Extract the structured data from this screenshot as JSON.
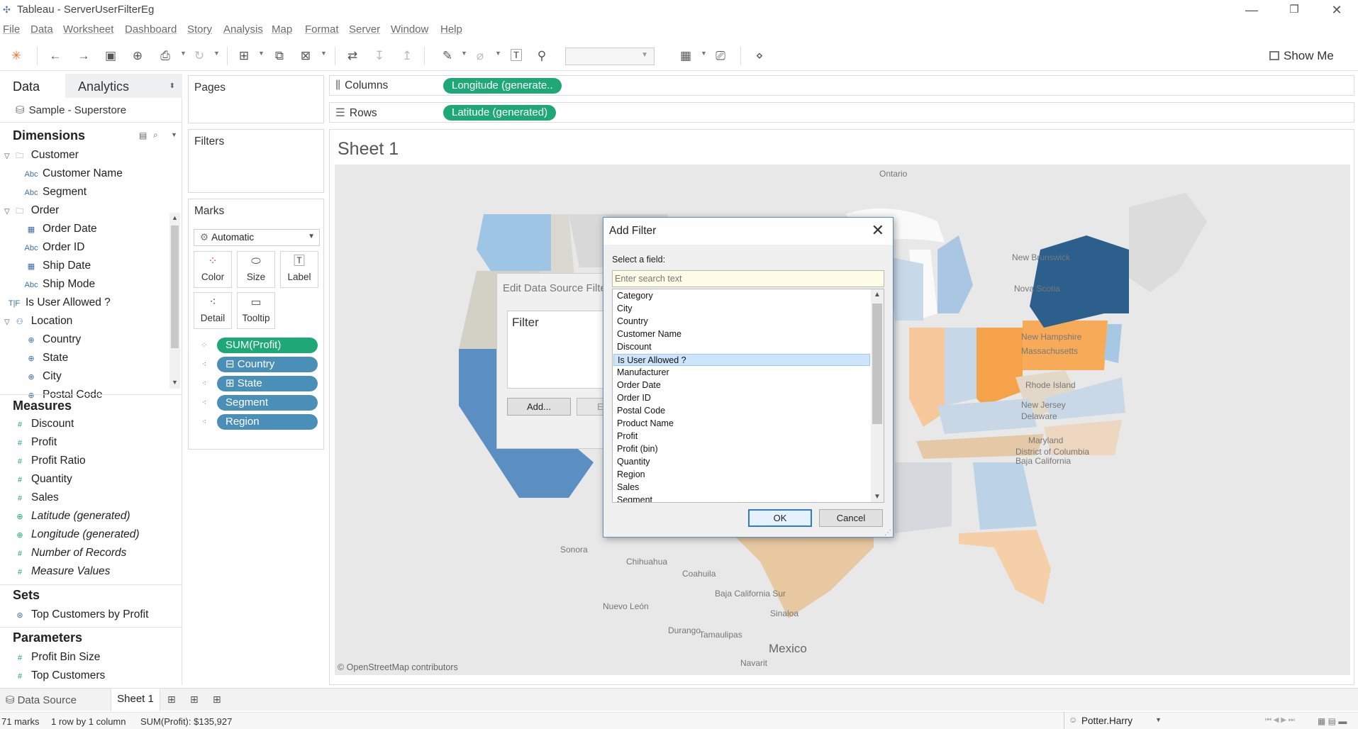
{
  "window": {
    "title": "Tableau - ServerUserFilterEg"
  },
  "menu": [
    "File",
    "Data",
    "Worksheet",
    "Dashboard",
    "Story",
    "Analysis",
    "Map",
    "Format",
    "Server",
    "Window",
    "Help"
  ],
  "toolbar": {
    "show_me": "Show Me"
  },
  "left_pane": {
    "tab_data": "Data",
    "tab_analytics": "Analytics",
    "source": "Sample - Superstore",
    "dimensions_title": "Dimensions",
    "dimensions": [
      {
        "label": "Customer",
        "icon": "folder-icon",
        "kind": "folder"
      },
      {
        "label": "Customer Name",
        "icon": "abc-icon",
        "kind": "field"
      },
      {
        "label": "Segment",
        "icon": "abc-icon",
        "kind": "field"
      },
      {
        "label": "Order",
        "icon": "folder-icon",
        "kind": "folder"
      },
      {
        "label": "Order Date",
        "icon": "calendar-icon",
        "kind": "field"
      },
      {
        "label": "Order ID",
        "icon": "abc-icon",
        "kind": "field"
      },
      {
        "label": "Ship Date",
        "icon": "calendar-icon",
        "kind": "field"
      },
      {
        "label": "Ship Mode",
        "icon": "abc-icon",
        "kind": "field"
      },
      {
        "label": "Is User Allowed ?",
        "icon": "tf-icon",
        "kind": "top"
      },
      {
        "label": "Location",
        "icon": "hierarchy-icon",
        "kind": "folder"
      },
      {
        "label": "Country",
        "icon": "globe-icon",
        "kind": "field"
      },
      {
        "label": "State",
        "icon": "globe-icon",
        "kind": "field"
      },
      {
        "label": "City",
        "icon": "globe-icon",
        "kind": "field"
      },
      {
        "label": "Postal Code",
        "icon": "globe-icon",
        "kind": "field"
      }
    ],
    "measures_title": "Measures",
    "measures": [
      {
        "label": "Discount",
        "italic": false
      },
      {
        "label": "Profit",
        "italic": false
      },
      {
        "label": "Profit Ratio",
        "italic": false
      },
      {
        "label": "Quantity",
        "italic": false
      },
      {
        "label": "Sales",
        "italic": false
      },
      {
        "label": "Latitude (generated)",
        "italic": true
      },
      {
        "label": "Longitude (generated)",
        "italic": true
      },
      {
        "label": "Number of Records",
        "italic": true
      },
      {
        "label": "Measure Values",
        "italic": true
      }
    ],
    "sets_title": "Sets",
    "sets": [
      "Top Customers by Profit"
    ],
    "parameters_title": "Parameters",
    "parameters": [
      "Profit Bin Size",
      "Top Customers"
    ]
  },
  "cards": {
    "pages": "Pages",
    "filters": "Filters",
    "marks": "Marks",
    "mark_type": "Automatic",
    "mark_buttons": [
      "Color",
      "Size",
      "Label",
      "Detail",
      "Tooltip"
    ],
    "mark_pills": [
      {
        "label": "SUM(Profit)",
        "color": "green",
        "icon": "color-icon"
      },
      {
        "label": "⊟ Country",
        "color": "blue",
        "icon": "detail-icon"
      },
      {
        "label": "⊞ State",
        "color": "blue",
        "icon": "detail-icon"
      },
      {
        "label": "Segment",
        "color": "blue",
        "icon": "detail-icon"
      },
      {
        "label": "Region",
        "color": "blue",
        "icon": "detail-icon"
      }
    ]
  },
  "shelves": {
    "columns_label": "Columns",
    "columns_pill": "Longitude (generate..",
    "rows_label": "Rows",
    "rows_pill": "Latitude (generated)"
  },
  "sheet": {
    "title": "Sheet 1",
    "attribution": "© OpenStreetMap contributors",
    "map_labels": [
      "Ontario",
      "New Brunswick",
      "Nova Scotia",
      "New Hampshire",
      "Massachusetts",
      "Rhode Island",
      "New Jersey",
      "Delaware",
      "Maryland",
      "District of Columbia",
      "Baja California",
      "Sonora",
      "Chihuahua",
      "Coahuila",
      "Baja California Sur",
      "Nuevo León",
      "Sinaloa",
      "Durango",
      "Tamaulipas",
      "Mexico",
      "Navarit"
    ]
  },
  "edit_dialog": {
    "title": "Edit Data Source Filte",
    "filter_header": "Filter",
    "add_button": "Add...",
    "second_button": "E"
  },
  "add_filter_dialog": {
    "title": "Add Filter",
    "prompt": "Select a field:",
    "search_placeholder": "Enter search text",
    "fields": [
      "Category",
      "City",
      "Country",
      "Customer Name",
      "Discount",
      "Is User Allowed ?",
      "Manufacturer",
      "Order Date",
      "Order ID",
      "Postal Code",
      "Product Name",
      "Profit",
      "Profit (bin)",
      "Quantity",
      "Region",
      "Sales",
      "Segment"
    ],
    "selected_field": "Is User Allowed ?",
    "ok": "OK",
    "cancel": "Cancel"
  },
  "bottom": {
    "data_source_tab": "Data Source",
    "sheet_tab": "Sheet 1",
    "status_marks": "71 marks",
    "status_rows": "1 row by 1 column",
    "status_sum": "SUM(Profit): $135,927",
    "user": "Potter.Harry"
  },
  "colors": {
    "accent_green": "#1fa877",
    "pill_blue": "#4a8fb8",
    "ny_dark_blue": "#2c5f8c",
    "orange": "#f5a24a"
  }
}
